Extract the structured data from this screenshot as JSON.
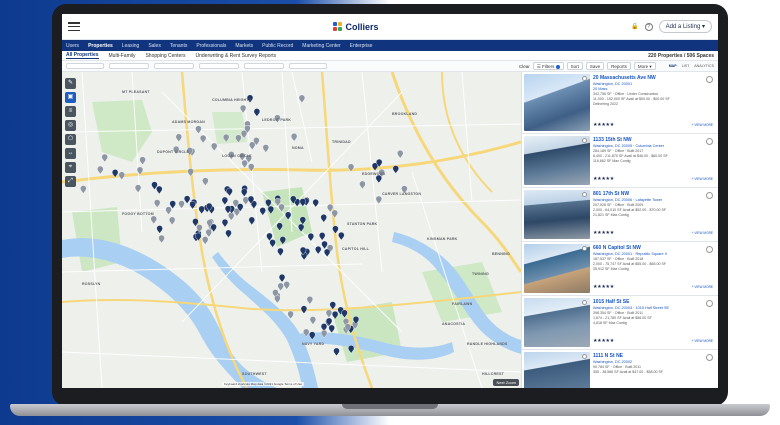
{
  "app": {
    "brand": "Colliers",
    "add_listing": "Add a Listing",
    "help_icon": "?",
    "nav": [
      "Users",
      "Properties",
      "Leasing",
      "Sales",
      "Tenants",
      "Professionals",
      "Markets",
      "Public Record",
      "Marketing Center",
      "Enterprise"
    ],
    "nav_active": 1,
    "subnav": [
      "All Properties",
      "Multi-Family",
      "Shopping Centers",
      "Underwriting & Rent Survey Reports"
    ],
    "subnav_active": 0,
    "count": "220 Properties / 506 Spaces",
    "filters": {
      "clear": "Clear",
      "filters": "Filters",
      "sort": "Sort",
      "save": "Save",
      "reports": "Reports",
      "more": "More"
    },
    "view_toggle": [
      "MAP",
      "LIST",
      "ANALYTICS"
    ],
    "view_active": 0
  },
  "map": {
    "labels": [
      "MT PLEASANT",
      "COLUMBIA HEIGHTS",
      "ADAMS MORGAN",
      "LEDROIT PARK",
      "DUPONT CIRCLE",
      "LOGAN CIRCLE",
      "NOMA",
      "TRINIDAD",
      "CAPITOL HILL",
      "STANTON PARK",
      "KINGMAN PARK",
      "NAVY YARD",
      "FOGGY BOTTOM",
      "SOUTHWEST",
      "ANACOSTIA",
      "ROSSLYN",
      "BROOKLAND",
      "EDGEWOOD",
      "CARVER LANGSTON",
      "FAIRLAWN",
      "TWINING",
      "RANDLE HIGHLANDS",
      "HILLCREST",
      "BENNING"
    ],
    "attribution": "Keyboard shortcuts   Map data ©2021 Google   Terms of Use",
    "zoom_label": "Next Zoom"
  },
  "listings": [
    {
      "address": "20 Massachusetts Ave NW",
      "city": "Washington, DC 20001",
      "sub": "20 Mass",
      "lines": [
        "342,756 SF · Office · Under Construction",
        "11,000 - 152,000 SF Avail at $00.00 - $00.00 SF",
        "Delivering 2022"
      ],
      "stars": "★★★★★",
      "more": "+ VIEW MORE"
    },
    {
      "address": "1133 15th St NW",
      "city": "Washington, DC 20005 · Columbia Center",
      "lines": [
        "284,189 SF · Office · Built 2017",
        "8,400 - 211,870 SF Avail at $46.00 - $60.00 SF",
        "116,662 SF Max Contig"
      ],
      "stars": "★★★★★",
      "more": "+ VIEW MORE"
    },
    {
      "address": "801 17th St NW",
      "city": "Washington, DC 20006 · Lafayette Tower",
      "lines": [
        "207,526 SF · Office · Built 2009",
        "2,000 - 64,010 SF Avail at $52.00 - $70.00 SF",
        "21,821 SF Max Contig"
      ],
      "stars": "★★★★★",
      "more": "+ VIEW MORE"
    },
    {
      "address": "660 N Capitol St NW",
      "city": "Washington, DC 20001 · Republic Square II",
      "lines": [
        "187,537 SF · Office · Built 2018",
        "2,000 - 75,747 SF Avail at $55.00 - $65.00 SF",
        "35,912 SF Max Contig"
      ],
      "stars": "★★★★★",
      "more": "+ VIEW MORE"
    },
    {
      "address": "1015 Half St SE",
      "city": "Washington, DC 20003 · 1015 Half Street SE",
      "lines": [
        "398,354 SF · Office · Built 2011",
        "1,674 - 21,780 SF Avail at $56.00 SF",
        "4,818 SF Max Contig"
      ],
      "stars": "★★★★★",
      "more": "+ VIEW MORE"
    },
    {
      "address": "1111 N St NE",
      "city": "Washington, DC 20002",
      "lines": [
        "90,784 SF · Office · Built 2011",
        "355 - 38,586 SF Avail at $47.00 - $58.00 SF"
      ],
      "stars": "",
      "more": ""
    }
  ],
  "colors": {
    "navy": "#10357e",
    "pin_dark": "#1e3766",
    "pin_gray": "#8d96a3",
    "water": "#a9cff2",
    "park": "#bfe3b6"
  }
}
